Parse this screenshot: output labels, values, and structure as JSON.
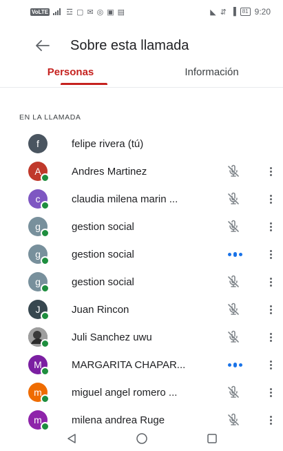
{
  "status_bar": {
    "network_label": "VoLTE",
    "time": "9:20",
    "battery": "81"
  },
  "header": {
    "title": "Sobre esta llamada"
  },
  "tabs": [
    {
      "label": "Personas",
      "active": true
    },
    {
      "label": "Información",
      "active": false
    }
  ],
  "section_label": "EN LA LLAMADA",
  "participants": [
    {
      "initial": "f",
      "name": "felipe rivera (tú)",
      "avatar_color": "#4a5560",
      "online": false,
      "mic": "none"
    },
    {
      "initial": "A",
      "name": "Andres Martinez",
      "avatar_color": "#c0392b",
      "online": true,
      "mic": "muted"
    },
    {
      "initial": "c",
      "name": "claudia milena marin ...",
      "avatar_color": "#7e57c2",
      "online": true,
      "mic": "muted"
    },
    {
      "initial": "g",
      "name": "gestion social",
      "avatar_color": "#78909c",
      "online": true,
      "mic": "muted"
    },
    {
      "initial": "g",
      "name": "gestion social",
      "avatar_color": "#78909c",
      "online": true,
      "mic": "speaking"
    },
    {
      "initial": "g",
      "name": "gestion social",
      "avatar_color": "#78909c",
      "online": true,
      "mic": "muted"
    },
    {
      "initial": "J",
      "name": "Juan Rincon",
      "avatar_color": "#37474f",
      "online": true,
      "mic": "muted"
    },
    {
      "initial": "",
      "name": "Juli Sanchez uwu",
      "avatar_color": "#555555",
      "online": true,
      "mic": "muted",
      "photo": true
    },
    {
      "initial": "M",
      "name": "MARGARITA CHAPAR...",
      "avatar_color": "#7b1fa2",
      "online": true,
      "mic": "speaking"
    },
    {
      "initial": "m",
      "name": "miguel angel romero ...",
      "avatar_color": "#ef6c00",
      "online": true,
      "mic": "muted"
    },
    {
      "initial": "m",
      "name": "milena andrea Ruge",
      "avatar_color": "#8e24aa",
      "online": true,
      "mic": "muted"
    }
  ],
  "colors": {
    "accent": "#c5221f",
    "speaking": "#1a73e8",
    "online_dot": "#1e8e3e"
  },
  "icons": {
    "back": "arrow-back-icon",
    "muted": "mic-off-icon",
    "speaking": "audio-level-icon",
    "more": "more-vert-icon"
  }
}
